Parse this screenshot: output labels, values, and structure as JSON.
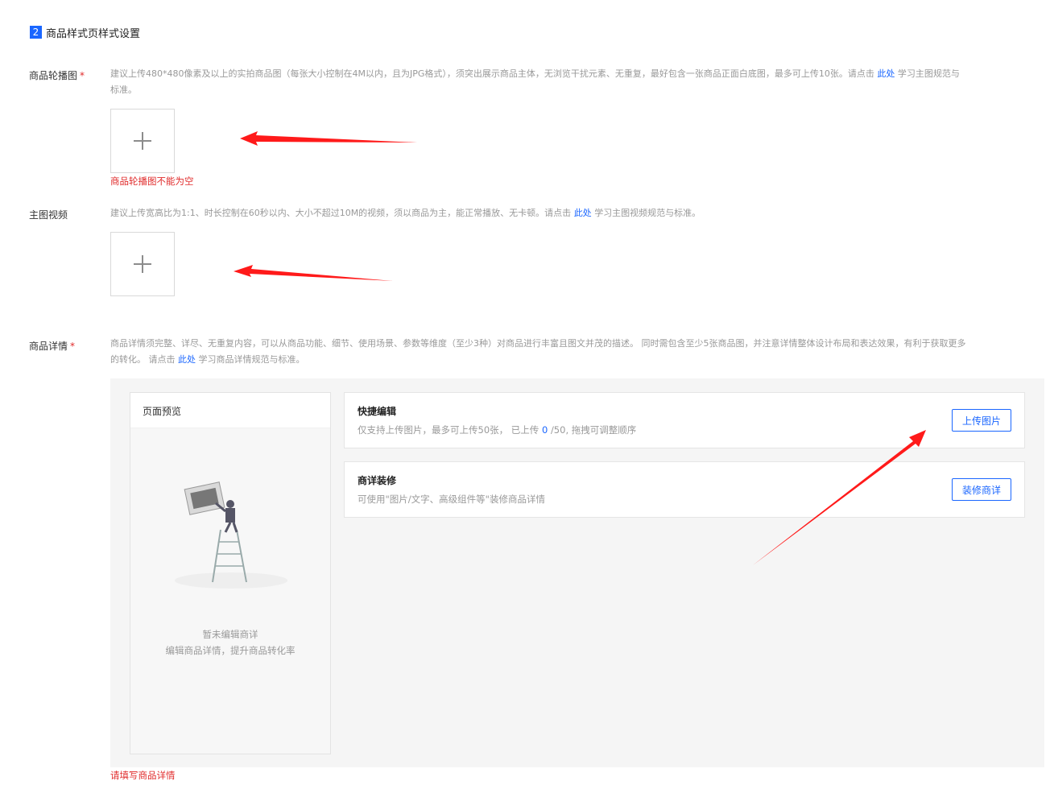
{
  "section": {
    "number": "2",
    "title": "商品样式页样式设置"
  },
  "carousel": {
    "label": "商品轮播图",
    "required_mark": "*",
    "hint_line1_pre": "建议上传480*480像素及以上的实拍商品图（每张大小控制在4M以内，且为JPG格式），须突出展示商品主体，无浏览干扰元素、无重复，最好包含一张商品正面白底图，最多可上传10张。请点击",
    "hint_link": "此处",
    "hint_line1_post": "学习主图规范与",
    "hint_line2": "标准。",
    "error": "商品轮播图不能为空"
  },
  "video": {
    "label": "主图视频",
    "hint_pre": "建议上传宽高比为1:1、时长控制在60秒以内、大小不超过10M的视频，须以商品为主，能正常播放、无卡顿。请点击",
    "hint_link": "此处",
    "hint_post": "学习主图视频规范与标准。"
  },
  "detail": {
    "label": "商品详情",
    "required_mark": "*",
    "hint_line1": "商品详情须完整、详尽、无重复内容，可以从商品功能、细节、使用场景、参数等维度（至少3种）对商品进行丰富且图文并茂的描述。 同时需包含至少5张商品图，并注意详情整体设计布局和表达效果，有利于获取更多",
    "hint_line2_pre": "的转化。 请点击",
    "hint_link": "此处",
    "hint_line2_post": "学习商品详情规范与标准。",
    "error": "请填写商品详情"
  },
  "preview": {
    "title": "页面预览",
    "empty_line1": "暂未编辑商详",
    "empty_line2": "编辑商品详情，提升商品转化率"
  },
  "quick_edit": {
    "title": "快捷编辑",
    "desc_pre": "仅支持上传图片，最多可上传50张， 已上传",
    "uploaded_count": "0",
    "desc_post": "/50, 拖拽可调整顺序",
    "button": "上传图片"
  },
  "decorate": {
    "title": "商详装修",
    "desc": "可使用\"图片/文字、高级组件等\"装修商品详情",
    "button": "装修商详"
  },
  "colors": {
    "accent": "#1a66ff",
    "error": "#e02b2b",
    "annotation_arrow": "#ff1a1a"
  }
}
